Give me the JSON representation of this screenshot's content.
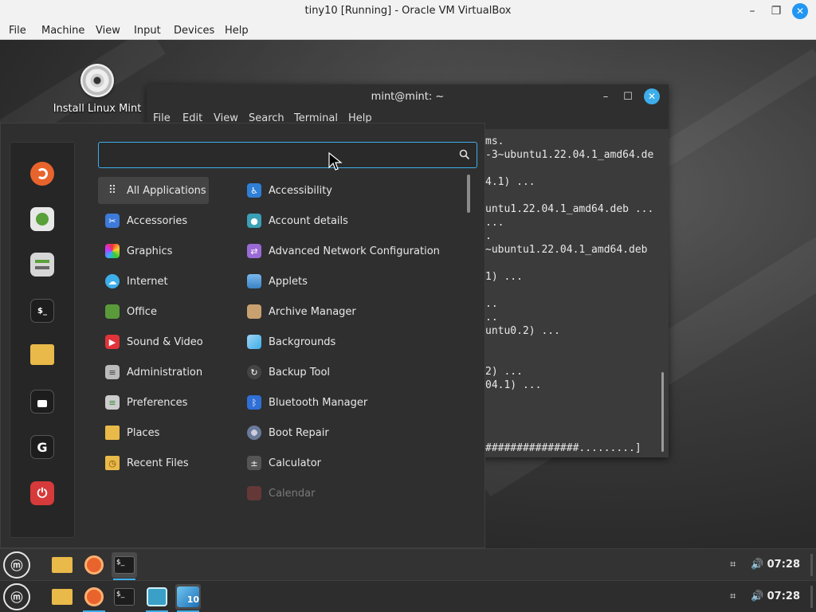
{
  "vbox": {
    "title": "tiny10 [Running] - Oracle VM VirtualBox",
    "menu": [
      "File",
      "Machine",
      "View",
      "Input",
      "Devices",
      "Help"
    ]
  },
  "desktop": {
    "icon_label": "Install Linux Mint"
  },
  "terminal": {
    "title": "mint@mint: ~",
    "menu": [
      "File",
      "Edit",
      "View",
      "Search",
      "Terminal",
      "Help"
    ],
    "lines": [
      "ms.",
      "-3~ubuntu1.22.04.1_amd64.de",
      "",
      "4.1) ...",
      "",
      "untu1.22.04.1_amd64.deb ...",
      "...",
      ".",
      "~ubuntu1.22.04.1_amd64.deb",
      "",
      "1) ...",
      "",
      "..",
      "..",
      "untu0.2) ...",
      "",
      "",
      "2) ...",
      "04.1) ...",
      "",
      "",
      "",
      "",
      "###############.........]"
    ]
  },
  "menu": {
    "search_value": "",
    "categories": [
      {
        "label": "All Applications",
        "icon": "grid-icon",
        "color": "#555555"
      },
      {
        "label": "Accessories",
        "icon": "scissors-icon",
        "color": "#3d7ad9"
      },
      {
        "label": "Graphics",
        "icon": "palette-icon",
        "color": "#d94ab3"
      },
      {
        "label": "Internet",
        "icon": "cloud-icon",
        "color": "#3daee9"
      },
      {
        "label": "Office",
        "icon": "office-icon",
        "color": "#5a9a3a"
      },
      {
        "label": "Sound & Video",
        "icon": "play-icon",
        "color": "#e0343a"
      },
      {
        "label": "Administration",
        "icon": "admin-icon",
        "color": "#bbbbbb"
      },
      {
        "label": "Preferences",
        "icon": "preferences-icon",
        "color": "#cccccc"
      },
      {
        "label": "Places",
        "icon": "folder-icon",
        "color": "#e9b949"
      },
      {
        "label": "Recent Files",
        "icon": "recent-icon",
        "color": "#e9b949"
      }
    ],
    "apps": [
      {
        "label": "Accessibility",
        "icon": "accessibility-icon",
        "color": "#2f7fd6"
      },
      {
        "label": "Account details",
        "icon": "account-icon",
        "color": "#3aa0b5"
      },
      {
        "label": "Advanced Network Configuration",
        "icon": "network-icon",
        "color": "#9b6ad6"
      },
      {
        "label": "Applets",
        "icon": "applets-icon",
        "color": "#5aa0e0"
      },
      {
        "label": "Archive Manager",
        "icon": "archive-icon",
        "color": "#c9a070"
      },
      {
        "label": "Backgrounds",
        "icon": "backgrounds-icon",
        "color": "#3daee9"
      },
      {
        "label": "Backup Tool",
        "icon": "backup-icon",
        "color": "#444444"
      },
      {
        "label": "Bluetooth Manager",
        "icon": "bluetooth-icon",
        "color": "#2f6fd6"
      },
      {
        "label": "Boot Repair",
        "icon": "boot-repair-icon",
        "color": "#6a7a9a"
      },
      {
        "label": "Calculator",
        "icon": "calculator-icon",
        "color": "#555555"
      },
      {
        "label": "Calendar",
        "icon": "calendar-icon",
        "color": "#d05050"
      }
    ],
    "favorites": [
      {
        "name": "firefox-icon",
        "color": "#e8642c",
        "glyph": "●"
      },
      {
        "name": "software-manager-icon",
        "color": "#e8e8e8",
        "glyph": "▦"
      },
      {
        "name": "settings-toggle-icon",
        "color": "#cfcfcf",
        "glyph": "≡"
      },
      {
        "name": "terminal-icon",
        "color": "#1d1d1d",
        "glyph": "$_"
      },
      {
        "name": "files-folder-icon",
        "color": "#e9b949",
        "glyph": ""
      },
      {
        "name": "lock-screen-icon",
        "color": "#1d1d1d",
        "glyph": "🔒"
      },
      {
        "name": "logout-icon",
        "color": "#1d1d1d",
        "glyph": "G"
      },
      {
        "name": "power-icon",
        "color": "#d63a3a",
        "glyph": "⏻"
      }
    ]
  },
  "panel_top": {
    "clock": "07:28"
  },
  "panel_bottom": {
    "clock": "07:28"
  }
}
